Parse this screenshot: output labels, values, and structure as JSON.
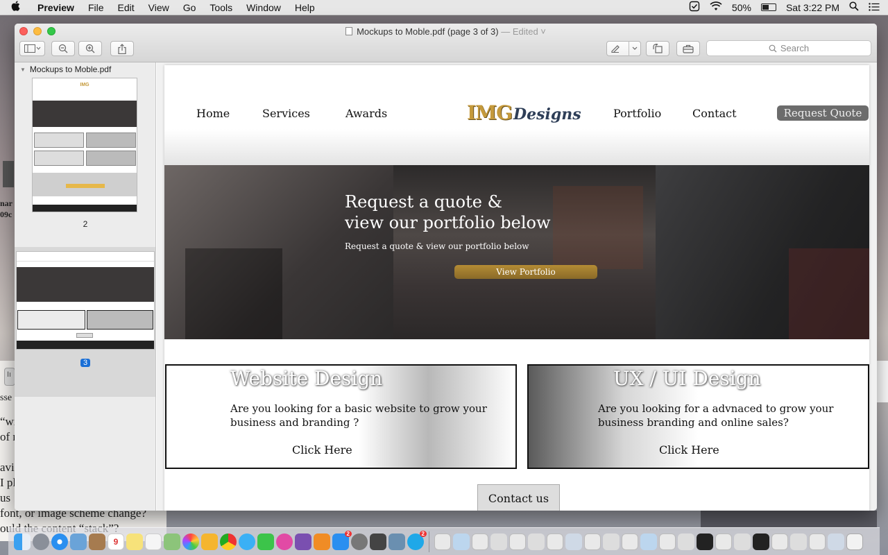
{
  "menubar": {
    "apple": "",
    "items": [
      "Preview",
      "File",
      "Edit",
      "View",
      "Go",
      "Tools",
      "Window",
      "Help"
    ],
    "battery": "50%",
    "clock": "Sat 3:22 PM"
  },
  "background": {
    "lines": [
      "“wil",
      "of r",
      "avi",
      "I pl",
      "us",
      "font, or image scheme change?",
      "ould the content “stack”?"
    ],
    "frag1": "nar",
    "frag2": "09c",
    "frag3": "sse",
    "frag4": "Iı"
  },
  "window": {
    "title": "Mockups to Moble.pdf (page 3 of 3)",
    "edited": "— Edited ˅",
    "search_placeholder": "Search"
  },
  "sidebar": {
    "file": "Mockups to Moble.pdf",
    "pages": [
      {
        "label": "2"
      },
      {
        "label": "3",
        "selected": true
      }
    ]
  },
  "page": {
    "nav": {
      "items": [
        "Home",
        "Services",
        "Awards",
        "Portfolio",
        "Contact"
      ],
      "logo_img": "IMG",
      "logo_designs": "Designs",
      "request_quote": "Request Quote"
    },
    "hero": {
      "heading_line1": "Request a quote &",
      "heading_line2": "view our portfolio below",
      "subtext": "Request a quote &  view our portfolio below",
      "button": "View Portfolio"
    },
    "cards": [
      {
        "title": "Website Design",
        "text": "Are you looking for a basic website to grow your business and branding ?",
        "link": "Click Here"
      },
      {
        "title": "UX / UI Design",
        "text": "Are you looking for a advnaced to grow your business branding and online sales?",
        "link": "Click Here"
      }
    ],
    "contact_button": "Contact us"
  },
  "colors": {
    "accent_gold": "#b48c35",
    "logo_navy": "#2e3e57",
    "selection_blue": "#1a6fd6"
  },
  "dock": {
    "icons": [
      "finder-icon",
      "launchpad-icon",
      "safari-icon",
      "mail-icon",
      "contacts-icon",
      "calendar-icon",
      "notes-icon",
      "reminders-icon",
      "maps-icon",
      "photos-icon",
      "sketch-icon",
      "chrome-icon",
      "messages-icon",
      "facetime-icon",
      "itunes-icon",
      "github-icon",
      "ibooks-icon",
      "appstore-icon",
      "system-prefs-icon",
      "sublime-icon",
      "preview-icon",
      "skype-icon"
    ],
    "calendar_day": "9",
    "badge_appstore": "2",
    "badge_skype": "2"
  }
}
